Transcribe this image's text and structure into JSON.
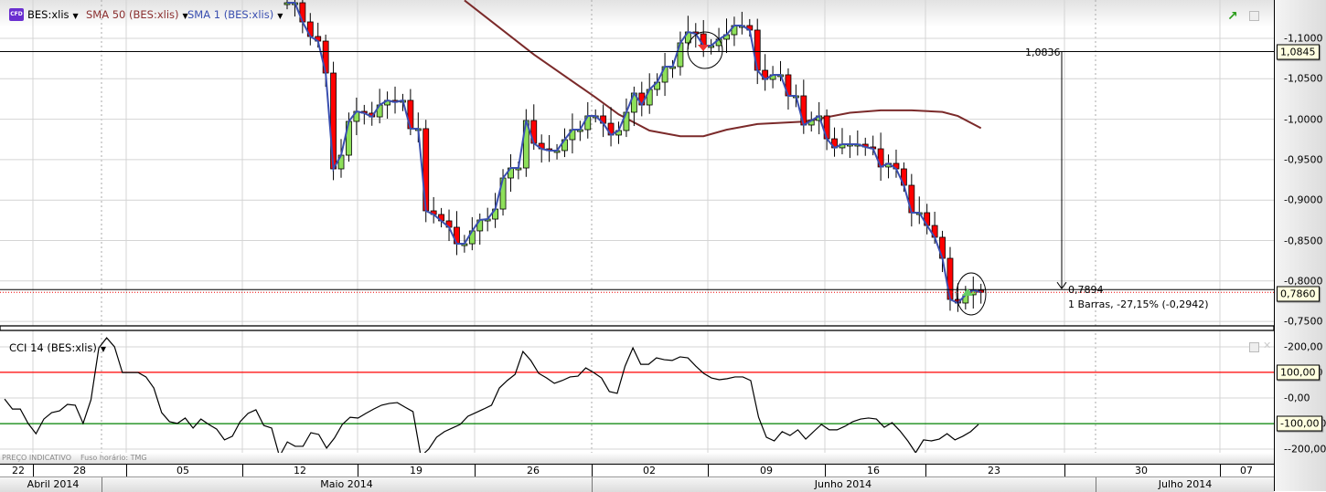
{
  "legend": {
    "symbol_badge": "CFD",
    "symbol": "BES:xlis",
    "sma50": "SMA 50 (BES:xlis)",
    "sma1": "SMA 1 (BES:xlis)",
    "cci": "CCI 14 (BES:xlis)",
    "caret": "▼"
  },
  "colors": {
    "up": "#8ee05a",
    "down": "#ff0000",
    "sma50": "#7b2a2a",
    "sma1": "#3a4fb0",
    "cci": "#000000",
    "overbought": "#ff0000",
    "oversold": "#008000"
  },
  "footer": {
    "price_note": "PREÇO INDICATIVO",
    "timezone": "Fuso horário: TMG"
  },
  "annotations": {
    "measure_top_value": "1,0836",
    "measure_bottom_value": "0,7894",
    "measure_summary": "1 Barras, -27,15% (-0,2942)",
    "price_tag_line": "1,0845",
    "price_tag_last": "0,7860",
    "cci_tag_upper": "100,00",
    "cci_tag_lower": "-100,00"
  },
  "x_axis": {
    "dates": [
      "22",
      "28",
      "05",
      "12",
      "19",
      "26",
      "02",
      "09",
      "16",
      "23",
      "30",
      "07"
    ],
    "months": [
      "Abril 2014",
      "Maio 2014",
      "Junho 2014",
      "Julho 2014"
    ]
  },
  "chart_data": [
    {
      "type": "candlestick",
      "title": "BES:xlis",
      "y_ticks": [
        "1,1000",
        "1,0500",
        "1,0000",
        "0,9500",
        "0,9000",
        "0,8500",
        "0,8000",
        "0,7500"
      ],
      "ylim": [
        0.74,
        1.15
      ],
      "close": [
        1.144,
        1.144,
        1.1203,
        1.1023,
        1.0966,
        1.0571,
        0.9386,
        0.9555,
        0.9973,
        1.0097,
        1.0075,
        1.0029,
        1.0176,
        1.0233,
        1.021,
        1.0233,
        0.9883,
        0.9883,
        0.8867,
        0.8822,
        0.8743,
        0.8664,
        0.846,
        0.846,
        0.8619,
        0.8754,
        0.8765,
        0.8889,
        0.9273,
        0.9397,
        0.9397,
        0.9984,
        0.9702,
        0.9634,
        0.9612,
        0.9612,
        0.9747,
        0.9871,
        0.9871,
        1.0041,
        1.0041,
        0.995,
        0.9804,
        0.986,
        1.0086,
        1.0323,
        1.0176,
        1.0368,
        1.0458,
        1.065,
        1.065,
        1.0944,
        1.1079,
        1.1056,
        1.091,
        1.091,
        1.0989,
        1.1045,
        1.1158,
        1.1158,
        1.1102,
        1.0605,
        1.0492,
        1.0549,
        1.0549,
        1.0289,
        1.0289,
        0.9928,
        0.9984,
        1.0041,
        0.9758,
        0.9646,
        0.9691,
        0.9691,
        0.9691,
        0.9657,
        0.9634,
        0.9409,
        0.9454,
        0.9386,
        0.9183,
        0.8844,
        0.8844,
        0.8686,
        0.854,
        0.828,
        0.7772,
        0.7727,
        0.7829,
        0.7885,
        0.786
      ],
      "sma50": [
        [
          23,
          1.147
        ],
        [
          32,
          1.08
        ],
        [
          40,
          1.027
        ],
        [
          43,
          1.006
        ],
        [
          47,
          0.986
        ],
        [
          51,
          0.979
        ],
        [
          54,
          0.979
        ],
        [
          57,
          0.987
        ],
        [
          61,
          0.994
        ],
        [
          67,
          0.997
        ],
        [
          73,
          1.008
        ],
        [
          77,
          1.011
        ],
        [
          81,
          1.011
        ],
        [
          85,
          1.009
        ],
        [
          87,
          1.004
        ],
        [
          90,
          0.989
        ]
      ],
      "horizontal_lines": [
        1.0836,
        0.7894
      ],
      "last_price": 0.786
    },
    {
      "type": "line",
      "title": "CCI 14 (BES:xlis)",
      "y_ticks": [
        "200,00",
        "100,00",
        "0,00",
        "-100,00",
        "-200,00"
      ],
      "ylim": [
        -200,
        200
      ],
      "levels": [
        100,
        -100
      ],
      "values": [
        -4,
        -43,
        -43,
        -99,
        -139,
        -82,
        -57,
        -50,
        -25,
        -28,
        -99,
        -7,
        195,
        234,
        199,
        99,
        99,
        99,
        82,
        39,
        -57,
        -92,
        -99,
        -78,
        -117,
        -82,
        -103,
        -121,
        -163,
        -149,
        -92,
        -60,
        -46,
        -107,
        -117,
        -227,
        -171,
        -188,
        -188,
        -135,
        -142,
        -195,
        -156,
        -103,
        -75,
        -78,
        -60,
        -43,
        -28,
        -21,
        -18,
        -36,
        -53,
        -227,
        -199,
        -153,
        -131,
        -117,
        -103,
        -71,
        -57,
        -43,
        -28,
        39,
        68,
        92,
        181,
        146,
        96,
        78,
        57,
        68,
        82,
        85,
        117,
        99,
        78,
        25,
        18,
        124,
        195,
        131,
        131,
        156,
        149,
        146,
        160,
        156,
        124,
        96,
        78,
        71,
        75,
        82,
        82,
        68,
        -75,
        -153,
        -167,
        -131,
        -146,
        -124,
        -160,
        -131,
        -103,
        -124,
        -124,
        -110,
        -92,
        -82,
        -78,
        -82,
        -114,
        -96,
        -128,
        -167,
        -213,
        -163,
        -167,
        -160,
        -139,
        -163,
        -149,
        -131,
        -103
      ]
    }
  ]
}
